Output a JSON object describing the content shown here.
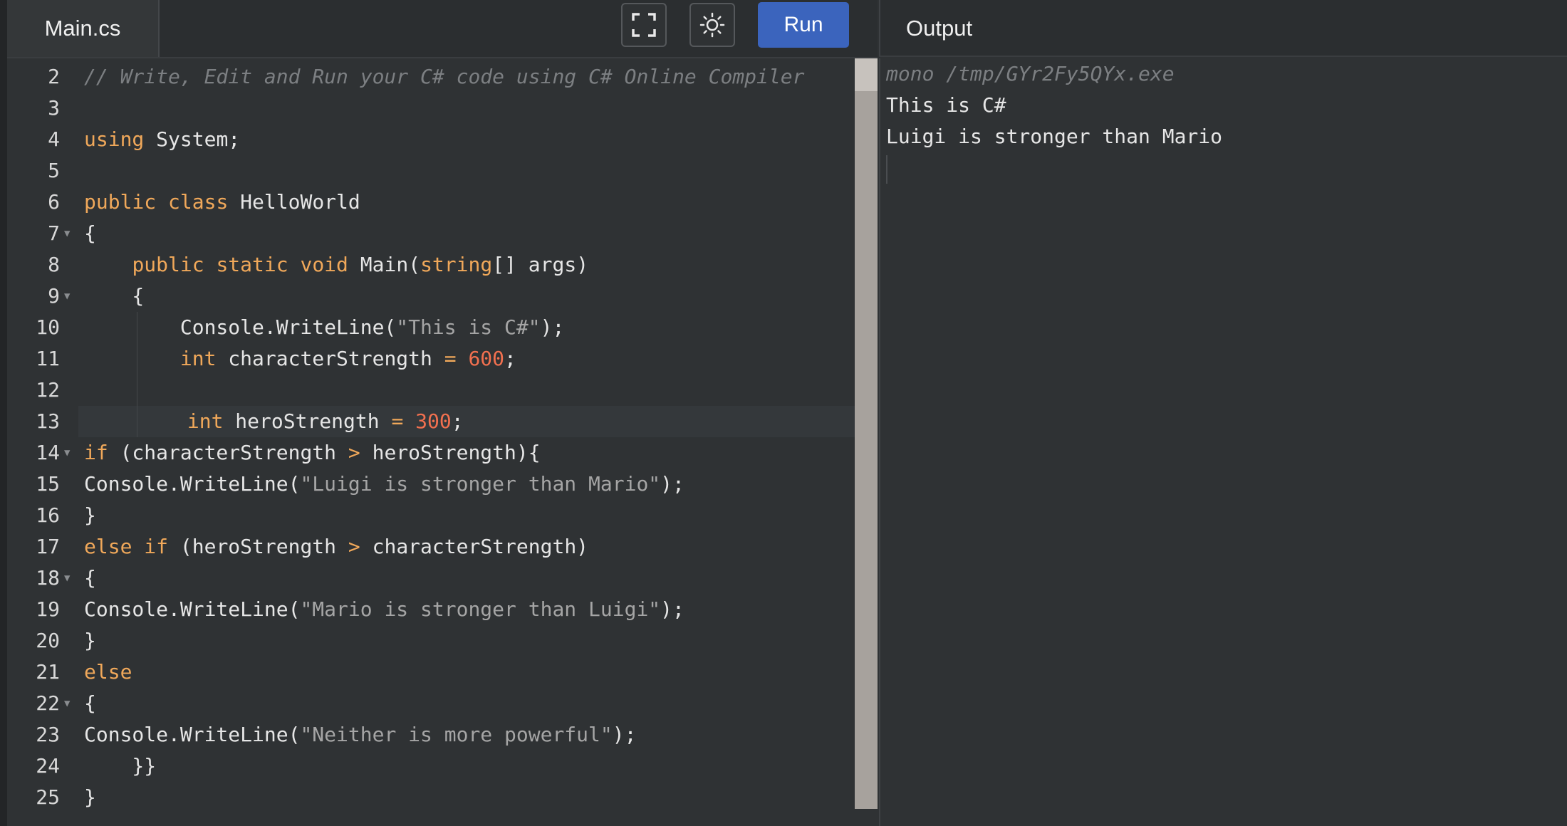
{
  "editor": {
    "file_tab": "Main.cs",
    "fullscreen_icon": "fullscreen-icon",
    "theme_icon": "sun-icon",
    "run_label": "Run",
    "lines": [
      {
        "n": "2",
        "segs": [
          {
            "t": "// Write, Edit and Run your C# code using C# Online Compiler",
            "c": "cmt"
          }
        ]
      },
      {
        "n": "3",
        "segs": []
      },
      {
        "n": "4",
        "segs": [
          {
            "t": "using",
            "c": "kw"
          },
          {
            "t": " System;"
          }
        ]
      },
      {
        "n": "5",
        "segs": []
      },
      {
        "n": "6",
        "segs": [
          {
            "t": "public",
            "c": "kw"
          },
          {
            "t": " "
          },
          {
            "t": "class",
            "c": "kw"
          },
          {
            "t": " HelloWorld"
          }
        ]
      },
      {
        "n": "7",
        "fold": true,
        "segs": [
          {
            "t": "{"
          }
        ]
      },
      {
        "n": "8",
        "segs": [
          {
            "t": "    "
          },
          {
            "t": "public",
            "c": "kw"
          },
          {
            "t": " "
          },
          {
            "t": "static",
            "c": "kw"
          },
          {
            "t": " "
          },
          {
            "t": "void",
            "c": "kw"
          },
          {
            "t": " Main("
          },
          {
            "t": "string",
            "c": "kw"
          },
          {
            "t": "[] args)"
          }
        ]
      },
      {
        "n": "9",
        "fold": true,
        "segs": [
          {
            "t": "    {"
          }
        ]
      },
      {
        "n": "10",
        "segs": [
          {
            "t": "        Console.WriteLine("
          },
          {
            "t": "\"This is C#\"",
            "c": "str"
          },
          {
            "t": ");"
          }
        ]
      },
      {
        "n": "11",
        "segs": [
          {
            "t": "        "
          },
          {
            "t": "int",
            "c": "kw"
          },
          {
            "t": " characterStrength "
          },
          {
            "t": "=",
            "c": "kw"
          },
          {
            "t": " "
          },
          {
            "t": "600",
            "c": "num"
          },
          {
            "t": ";"
          }
        ]
      },
      {
        "n": "12",
        "segs": []
      },
      {
        "n": "13",
        "active": true,
        "segs": [
          {
            "t": "        "
          },
          {
            "t": "int",
            "c": "kw"
          },
          {
            "t": " heroStrength "
          },
          {
            "t": "=",
            "c": "kw"
          },
          {
            "t": " "
          },
          {
            "t": "300",
            "c": "num"
          },
          {
            "t": ";"
          }
        ]
      },
      {
        "n": "14",
        "fold": true,
        "segs": [
          {
            "t": "if",
            "c": "kw"
          },
          {
            "t": " (characterStrength "
          },
          {
            "t": ">",
            "c": "kw"
          },
          {
            "t": " heroStrength){"
          }
        ]
      },
      {
        "n": "15",
        "segs": [
          {
            "t": "Console.WriteLine("
          },
          {
            "t": "\"Luigi is stronger than Mario\"",
            "c": "str"
          },
          {
            "t": ");"
          }
        ]
      },
      {
        "n": "16",
        "segs": [
          {
            "t": "}"
          }
        ]
      },
      {
        "n": "17",
        "segs": [
          {
            "t": "else",
            "c": "kw"
          },
          {
            "t": " "
          },
          {
            "t": "if",
            "c": "kw"
          },
          {
            "t": " (heroStrength "
          },
          {
            "t": ">",
            "c": "kw"
          },
          {
            "t": " characterStrength)"
          }
        ]
      },
      {
        "n": "18",
        "fold": true,
        "segs": [
          {
            "t": "{"
          }
        ]
      },
      {
        "n": "19",
        "segs": [
          {
            "t": "Console.WriteLine("
          },
          {
            "t": "\"Mario is stronger than Luigi\"",
            "c": "str"
          },
          {
            "t": ");"
          }
        ]
      },
      {
        "n": "20",
        "segs": [
          {
            "t": "}"
          }
        ]
      },
      {
        "n": "21",
        "segs": [
          {
            "t": "else",
            "c": "kw"
          }
        ]
      },
      {
        "n": "22",
        "fold": true,
        "segs": [
          {
            "t": "{"
          }
        ]
      },
      {
        "n": "23",
        "segs": [
          {
            "t": "Console.WriteLine("
          },
          {
            "t": "\"Neither is more powerful\"",
            "c": "str"
          },
          {
            "t": ");"
          }
        ]
      },
      {
        "n": "24",
        "segs": [
          {
            "t": "    }}"
          }
        ]
      },
      {
        "n": "25",
        "segs": [
          {
            "t": "}"
          }
        ]
      }
    ]
  },
  "output": {
    "title": "Output",
    "command": "mono /tmp/GYr2Fy5QYx.exe",
    "lines": [
      "This is C#",
      "Luigi is stronger than Mario"
    ]
  },
  "colors": {
    "keyword": "#f0a85a",
    "string": "#a5a5a5",
    "number": "#f2704f",
    "comment": "#7c7f82",
    "run_button": "#3b64bd",
    "background": "#2f3234"
  }
}
